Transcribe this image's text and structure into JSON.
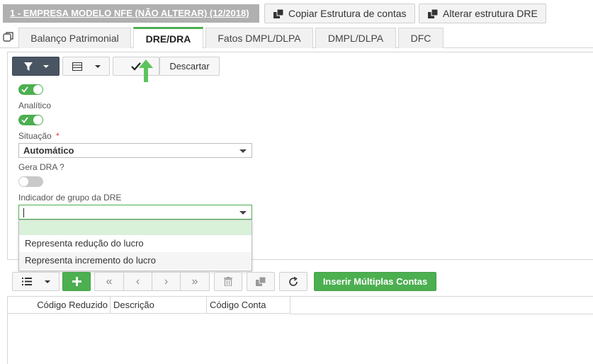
{
  "header": {
    "company": "1 - EMPRESA MODELO NFE (NÃO ALTERAR) (12/2018)",
    "copy_structure": "Copiar Estrutura de contas",
    "change_dre": "Alterar estrutura DRE"
  },
  "tabs": [
    {
      "label": "Balanço Patrimonial"
    },
    {
      "label": "DRE/DRA"
    },
    {
      "label": "Fatos DMPL/DLPA"
    },
    {
      "label": "DMPL/DLPA"
    },
    {
      "label": "DFC"
    }
  ],
  "toolbar": {
    "discard_label": "Descartar"
  },
  "form": {
    "analitico_label": "Analítico",
    "situacao_label": "Situação",
    "required_mark": "*",
    "situacao_value": "Automático",
    "gera_dra_label": "Gera DRA ?",
    "indicador_label": "Indicador de grupo da DRE",
    "indicador_value": "",
    "indicador_options": [
      "",
      "Representa redução do lucro",
      "Representa incremento do lucro"
    ]
  },
  "grid": {
    "insert_multiple": "Inserir Múltiplas Contas",
    "columns": [
      "Código Reduzido",
      "Descrição",
      "Código Conta"
    ]
  },
  "colors": {
    "accent_green": "#4caf50",
    "dark_button": "#4a5563",
    "highlight": "#d9f0d9"
  }
}
